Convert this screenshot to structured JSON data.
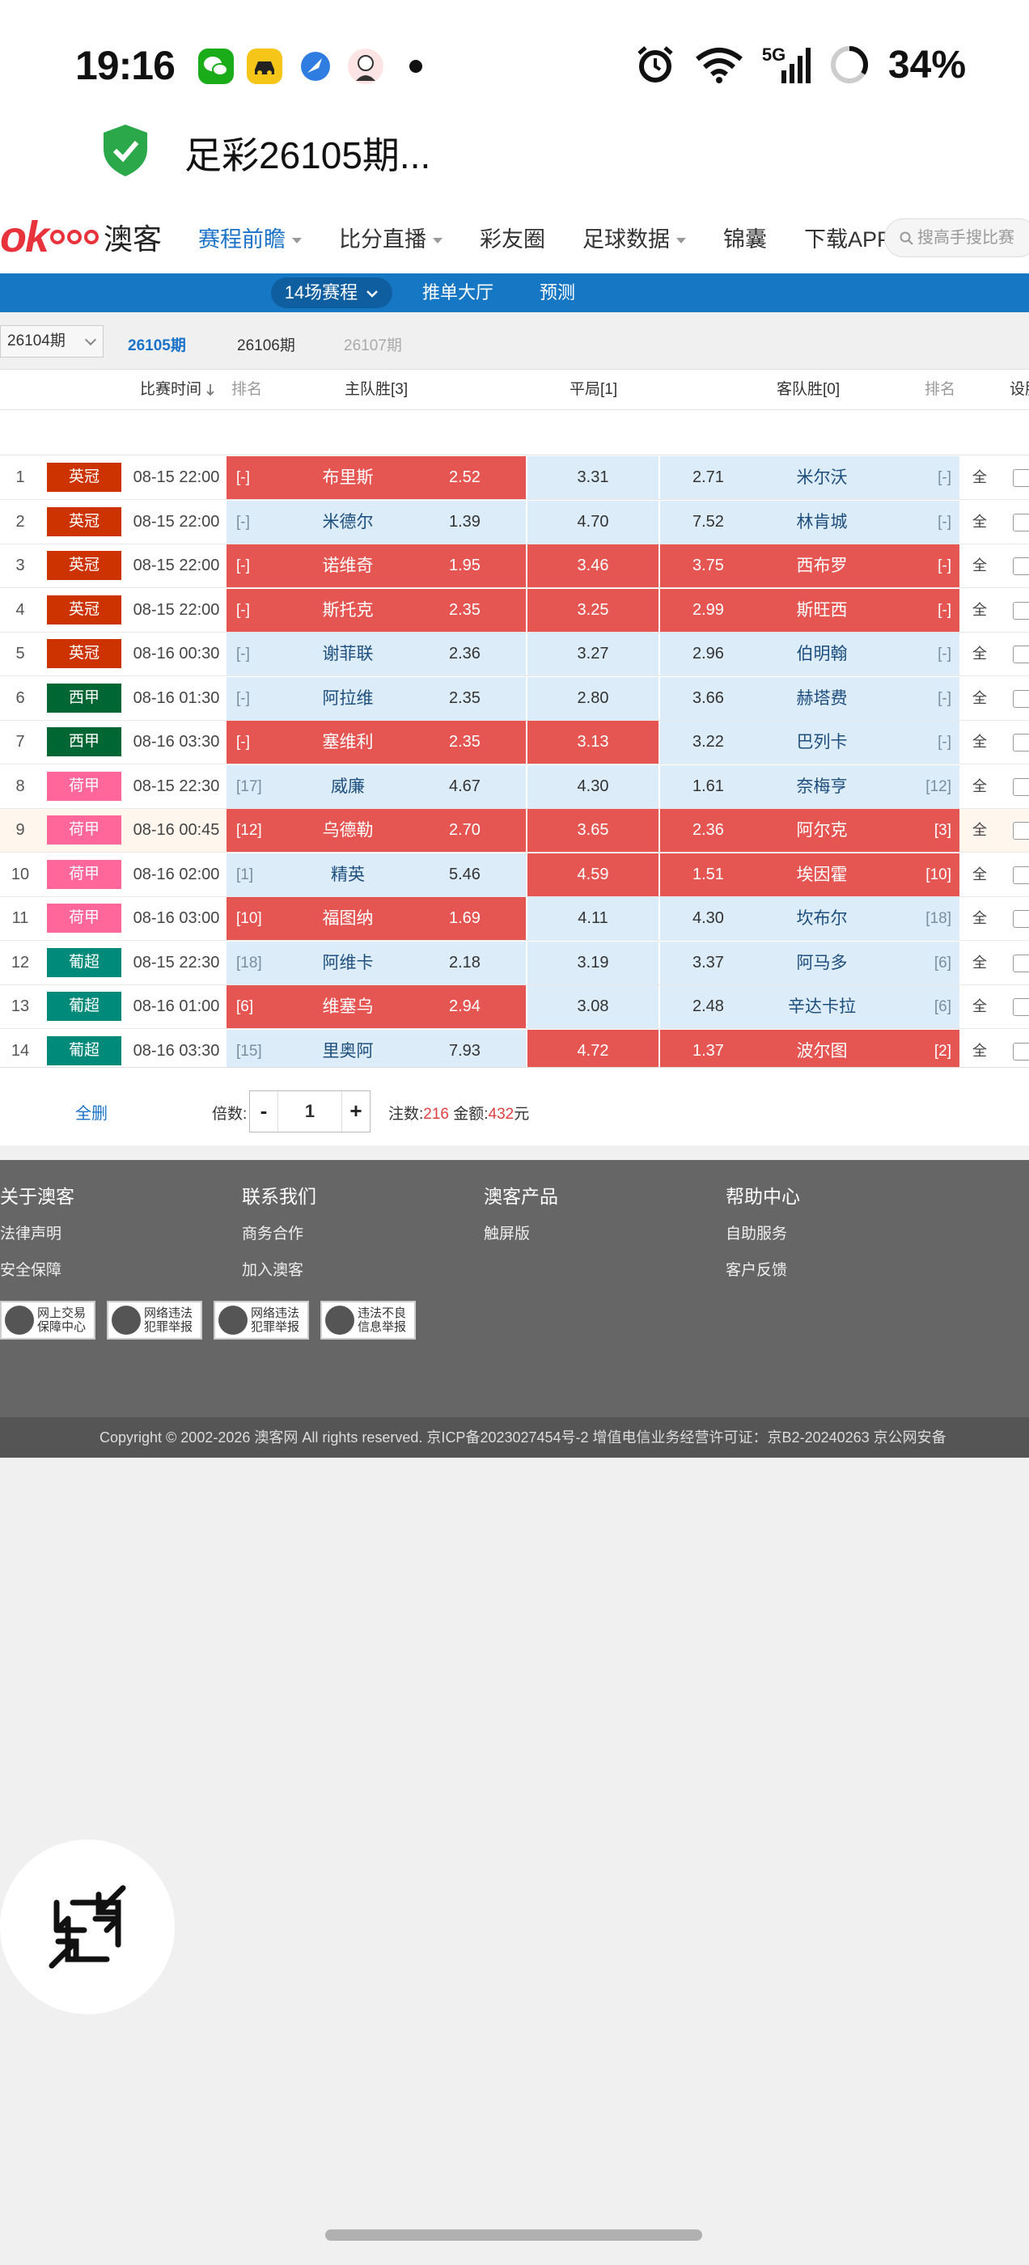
{
  "status_bar": {
    "time": "19:16",
    "network": "5G",
    "battery": "34%",
    "battery_level": 0.34
  },
  "url_bar": {
    "title": "足彩26105期..."
  },
  "site_nav": {
    "logo_text": "澳客",
    "items": [
      {
        "label": "赛程前瞻",
        "active": true,
        "dropdown": true
      },
      {
        "label": "比分直播",
        "active": false,
        "dropdown": true
      },
      {
        "label": "彩友圈",
        "active": false,
        "dropdown": false
      },
      {
        "label": "足球数据",
        "active": false,
        "dropdown": true
      },
      {
        "label": "锦囊",
        "active": false,
        "dropdown": false
      },
      {
        "label": "下载APP",
        "active": false,
        "dropdown": false
      }
    ],
    "search_placeholder": "搜高手搜比赛"
  },
  "sub_nav": {
    "items": [
      "14场赛程",
      "推单大厅",
      "预测"
    ]
  },
  "issues": {
    "selected": "26104期",
    "tabs": [
      {
        "label": "26105期",
        "state": "active"
      },
      {
        "label": "26106期",
        "state": "normal"
      },
      {
        "label": "26107期",
        "state": "disabled"
      }
    ]
  },
  "table": {
    "headers": {
      "time": "比赛时间",
      "rank_home": "排名",
      "home": "主队胜[3]",
      "draw": "平局[1]",
      "away": "客队胜[0]",
      "rank_away": "排名",
      "settings": "设胆"
    },
    "rows": [
      {
        "no": "1",
        "league": "英冠",
        "lcolor": "#cc3300",
        "time": "08-15 22:00",
        "hrank": "[-]",
        "home": "布里斯",
        "hodds": "2.52",
        "draw": "3.31",
        "aodds": "2.71",
        "away": "米尔沃",
        "arank": "[-]",
        "hs": true,
        "ds": false,
        "as": false,
        "all": "全"
      },
      {
        "no": "2",
        "league": "英冠",
        "lcolor": "#cc3300",
        "time": "08-15 22:00",
        "hrank": "[-]",
        "home": "米德尔",
        "hodds": "1.39",
        "draw": "4.70",
        "aodds": "7.52",
        "away": "林肯城",
        "arank": "[-]",
        "hs": false,
        "ds": false,
        "as": false,
        "all": "全"
      },
      {
        "no": "3",
        "league": "英冠",
        "lcolor": "#cc3300",
        "time": "08-15 22:00",
        "hrank": "[-]",
        "home": "诺维奇",
        "hodds": "1.95",
        "draw": "3.46",
        "aodds": "3.75",
        "away": "西布罗",
        "arank": "[-]",
        "hs": true,
        "ds": true,
        "as": true,
        "all": "全"
      },
      {
        "no": "4",
        "league": "英冠",
        "lcolor": "#cc3300",
        "time": "08-15 22:00",
        "hrank": "[-]",
        "home": "斯托克",
        "hodds": "2.35",
        "draw": "3.25",
        "aodds": "2.99",
        "away": "斯旺西",
        "arank": "[-]",
        "hs": true,
        "ds": true,
        "as": true,
        "all": "全"
      },
      {
        "no": "5",
        "league": "英冠",
        "lcolor": "#cc3300",
        "time": "08-16 00:30",
        "hrank": "[-]",
        "home": "谢菲联",
        "hodds": "2.36",
        "draw": "3.27",
        "aodds": "2.96",
        "away": "伯明翰",
        "arank": "[-]",
        "hs": false,
        "ds": false,
        "as": false,
        "all": "全"
      },
      {
        "no": "6",
        "league": "西甲",
        "lcolor": "#006633",
        "time": "08-16 01:30",
        "hrank": "[-]",
        "home": "阿拉维",
        "hodds": "2.35",
        "draw": "2.80",
        "aodds": "3.66",
        "away": "赫塔费",
        "arank": "[-]",
        "hs": false,
        "ds": false,
        "as": false,
        "all": "全"
      },
      {
        "no": "7",
        "league": "西甲",
        "lcolor": "#006633",
        "time": "08-16 03:30",
        "hrank": "[-]",
        "home": "塞维利",
        "hodds": "2.35",
        "draw": "3.13",
        "aodds": "3.22",
        "away": "巴列卡",
        "arank": "[-]",
        "hs": true,
        "ds": true,
        "as": false,
        "all": "全"
      },
      {
        "no": "8",
        "league": "荷甲",
        "lcolor": "#ff6699",
        "time": "08-15 22:30",
        "hrank": "[17]",
        "home": "威廉",
        "hodds": "4.67",
        "draw": "4.30",
        "aodds": "1.61",
        "away": "奈梅亨",
        "arank": "[12]",
        "hs": false,
        "ds": false,
        "as": false,
        "all": "全"
      },
      {
        "no": "9",
        "league": "荷甲",
        "lcolor": "#ff6699",
        "time": "08-16 00:45",
        "hrank": "[12]",
        "home": "乌德勒",
        "hodds": "2.70",
        "draw": "3.65",
        "aodds": "2.36",
        "away": "阿尔克",
        "arank": "[3]",
        "hs": true,
        "ds": true,
        "as": true,
        "all": "全",
        "hl": true
      },
      {
        "no": "10",
        "league": "荷甲",
        "lcolor": "#ff6699",
        "time": "08-16 02:00",
        "hrank": "[1]",
        "home": "精英",
        "hodds": "5.46",
        "draw": "4.59",
        "aodds": "1.51",
        "away": "埃因霍",
        "arank": "[10]",
        "hs": false,
        "ds": true,
        "as": true,
        "all": "全"
      },
      {
        "no": "11",
        "league": "荷甲",
        "lcolor": "#ff6699",
        "time": "08-16 03:00",
        "hrank": "[10]",
        "home": "福图纳",
        "hodds": "1.69",
        "draw": "4.11",
        "aodds": "4.30",
        "away": "坎布尔",
        "arank": "[18]",
        "hs": true,
        "ds": false,
        "as": false,
        "all": "全"
      },
      {
        "no": "12",
        "league": "葡超",
        "lcolor": "#008a7a",
        "time": "08-15 22:30",
        "hrank": "[18]",
        "home": "阿维卡",
        "hodds": "2.18",
        "draw": "3.19",
        "aodds": "3.37",
        "away": "阿马多",
        "arank": "[6]",
        "hs": false,
        "ds": false,
        "as": false,
        "all": "全"
      },
      {
        "no": "13",
        "league": "葡超",
        "lcolor": "#008a7a",
        "time": "08-16 01:00",
        "hrank": "[6]",
        "home": "维塞乌",
        "hodds": "2.94",
        "draw": "3.08",
        "aodds": "2.48",
        "away": "辛达卡拉",
        "arank": "[6]",
        "hs": true,
        "ds": false,
        "as": false,
        "all": "全"
      },
      {
        "no": "14",
        "league": "葡超",
        "lcolor": "#008a7a",
        "time": "08-16 03:30",
        "hrank": "[15]",
        "home": "里奥阿",
        "hodds": "7.93",
        "draw": "4.72",
        "aodds": "1.37",
        "away": "波尔图",
        "arank": "[2]",
        "hs": false,
        "ds": true,
        "as": true,
        "all": "全"
      }
    ]
  },
  "bet_bar": {
    "clear": "全删",
    "multiplier_label": "倍数:",
    "minus": "-",
    "multiplier": "1",
    "plus": "+",
    "count_label": "注数:",
    "count": "216",
    "amount_label": "金额:",
    "amount": "432",
    "unit": "元"
  },
  "footer": {
    "columns": [
      {
        "title": "关于澳客",
        "links": [
          "法律声明",
          "安全保障"
        ]
      },
      {
        "title": "联系我们",
        "links": [
          "商务合作",
          "加入澳客"
        ]
      },
      {
        "title": "澳客产品",
        "links": [
          "触屏版"
        ]
      },
      {
        "title": "帮助中心",
        "links": [
          "自助服务",
          "客户反馈"
        ]
      }
    ],
    "badges": [
      [
        "网上交易",
        "保障中心"
      ],
      [
        "网络违法",
        "犯罪举报"
      ],
      [
        "网络违法",
        "犯罪举报"
      ],
      [
        "违法不良",
        "信息举报"
      ]
    ],
    "copyright": "Copyright © 2002-2026 澳客网  All rights reserved.   京ICP备2023027454号-2  增值电信业务经营许可证：京B2-20240263  京公网安备"
  },
  "colors": {
    "accent_blue": "#1677c4",
    "selected_red": "#e55552",
    "cell_blue": "#dcecf8"
  }
}
